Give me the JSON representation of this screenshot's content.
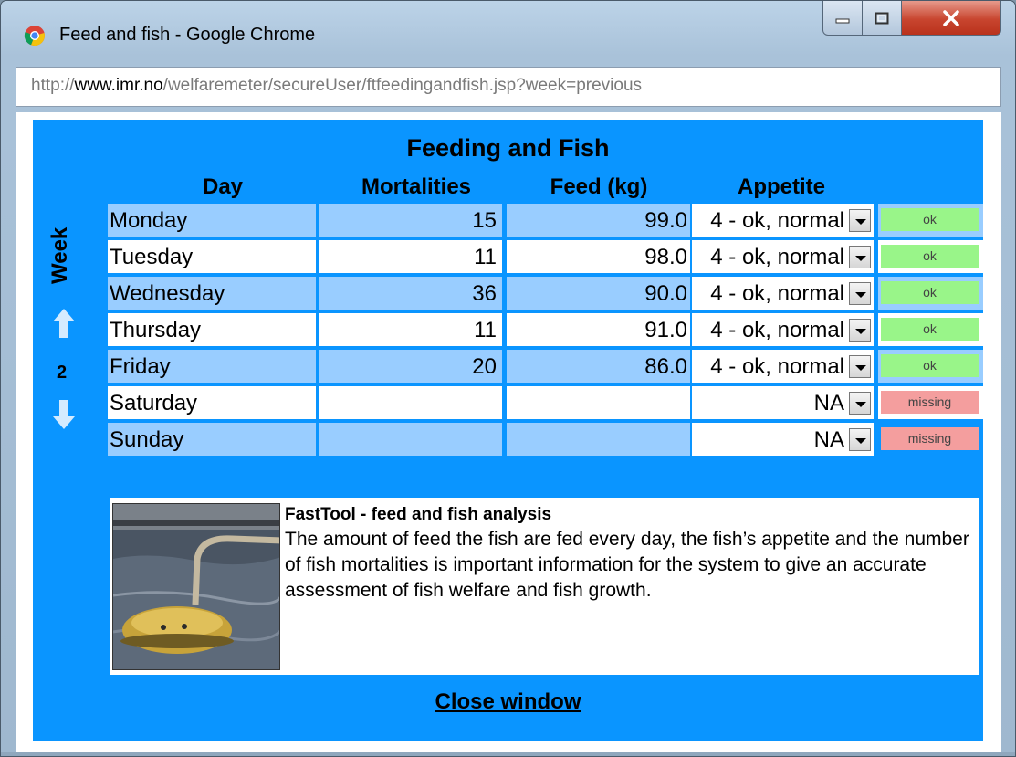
{
  "window": {
    "title": "Feed and fish - Google Chrome",
    "url_scheme": "http://",
    "url_host": "www.imr.no",
    "url_path": "/welfaremeter/secureUser/ftfeedingandfish.jsp?week=previous"
  },
  "panel": {
    "title": "Feeding and Fish",
    "week_label": "Week",
    "week_number": "2",
    "columns": [
      "Day",
      "Mortalities",
      "Feed (kg)",
      "Appetite"
    ],
    "rows": [
      {
        "day": "Monday",
        "mortalities": "15",
        "feed": "99.0",
        "appetite": "4 - ok, normal",
        "status": "ok"
      },
      {
        "day": "Tuesday",
        "mortalities": "11",
        "feed": "98.0",
        "appetite": "4 - ok, normal",
        "status": "ok"
      },
      {
        "day": "Wednesday",
        "mortalities": "36",
        "feed": "90.0",
        "appetite": "4 - ok, normal",
        "status": "ok"
      },
      {
        "day": "Thursday",
        "mortalities": "11",
        "feed": "91.0",
        "appetite": "4 - ok, normal",
        "status": "ok"
      },
      {
        "day": "Friday",
        "mortalities": "20",
        "feed": "86.0",
        "appetite": "4 - ok, normal",
        "status": "ok"
      },
      {
        "day": "Saturday",
        "mortalities": "",
        "feed": "",
        "appetite": "NA",
        "status": "missing"
      },
      {
        "day": "Sunday",
        "mortalities": "",
        "feed": "",
        "appetite": "NA",
        "status": "missing"
      }
    ]
  },
  "info": {
    "title": "FastTool - feed and fish analysis",
    "text": "The amount of feed the fish are fed every day, the fish’s appetite and the number of fish mortalities is important information for the system to give an accurate assessment of fish welfare and fish growth."
  },
  "close_label": "Close window",
  "colors": {
    "panel": "#0a95ff",
    "row_light": "#99cdff",
    "status_ok": "#99f589",
    "status_missing": "#f49e9e"
  },
  "icons": [
    "chrome-logo-icon",
    "minimize-icon",
    "maximize-icon",
    "close-icon",
    "week-up-arrow-icon",
    "week-down-arrow-icon"
  ]
}
